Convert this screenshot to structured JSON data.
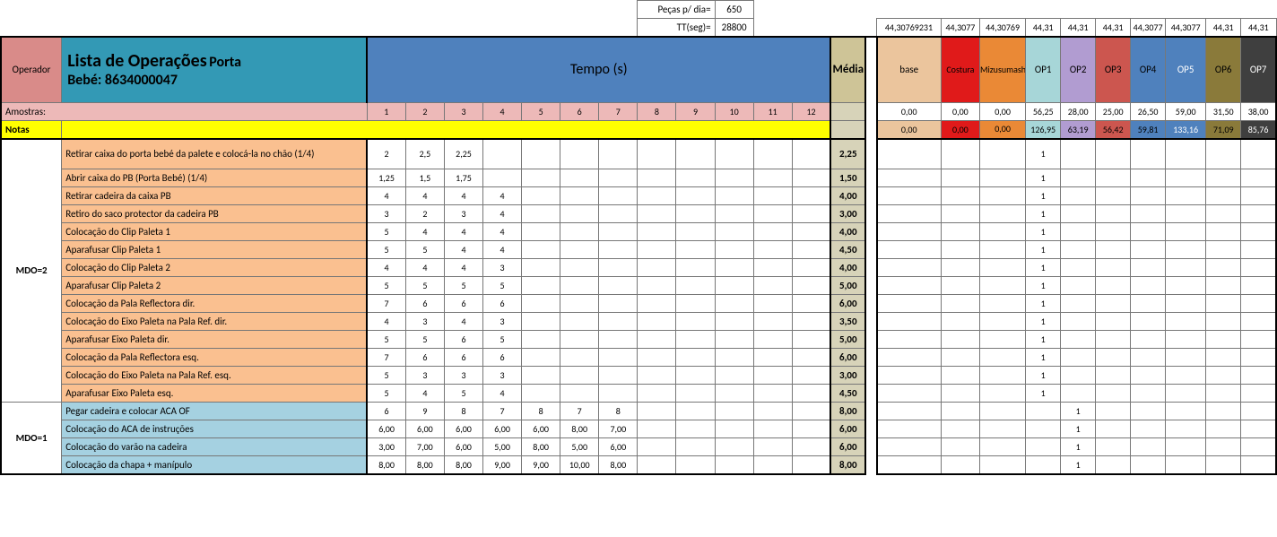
{
  "header": {
    "pecas_label": "Peças p/ dia=",
    "pecas_value": "650",
    "tt_label": "TT(seg)=",
    "tt_value": "28800",
    "top_right_values": [
      "44,30769231",
      "44,3077",
      "44,30769",
      "44,31",
      "44,31",
      "44,31",
      "44,3077",
      "44,3077",
      "44,31",
      "44,31"
    ],
    "operador": "Operador",
    "title_main": "Lista de Operações",
    "title_sub1": "Porta",
    "title_sub2": "Bebé: 8634000047",
    "tempo": "Tempo (s)",
    "media": "Média",
    "cols_op": [
      "base",
      "Costura",
      "Mizusumashi",
      "OP1",
      "OP2",
      "OP3",
      "OP4",
      "OP5",
      "OP6",
      "OP7"
    ],
    "amostras": "Amostras:",
    "samples": [
      "1",
      "2",
      "3",
      "4",
      "5",
      "6",
      "7",
      "8",
      "9",
      "10",
      "11",
      "12"
    ],
    "amostras_right": [
      "0,00",
      "0,00",
      "0,00",
      "56,25",
      "28,00",
      "25,00",
      "26,50",
      "59,00",
      "31,50",
      "38,00"
    ],
    "notas": "Notas",
    "notas_right": [
      "0,00",
      "0,00",
      "0,00",
      "126,95",
      "63,19",
      "56,42",
      "59,81",
      "133,16",
      "71,09",
      "85,76"
    ]
  },
  "groups": [
    {
      "mdo": "MDO=2",
      "rowclass": "op-row-orange",
      "rows": [
        {
          "desc": "Retirar caixa do porta bebé da palete e colocá-la no chão (1/4)",
          "t": [
            "2",
            "2,5",
            "2,25",
            "",
            "",
            "",
            "",
            "",
            "",
            "",
            "",
            ""
          ],
          "media": "2,25",
          "op": [
            "",
            "",
            "",
            "1",
            "",
            "",
            "",
            "",
            "",
            ""
          ]
        },
        {
          "desc": "Abrir caixa do PB (Porta Bebé) (1/4)",
          "t": [
            "1,25",
            "1,5",
            "1,75",
            "",
            "",
            "",
            "",
            "",
            "",
            "",
            "",
            ""
          ],
          "media": "1,50",
          "op": [
            "",
            "",
            "",
            "1",
            "",
            "",
            "",
            "",
            "",
            ""
          ]
        },
        {
          "desc": "Retirar cadeira da caixa PB",
          "t": [
            "4",
            "4",
            "4",
            "4",
            "",
            "",
            "",
            "",
            "",
            "",
            "",
            ""
          ],
          "media": "4,00",
          "op": [
            "",
            "",
            "",
            "1",
            "",
            "",
            "",
            "",
            "",
            ""
          ]
        },
        {
          "desc": "Retiro do saco protector da cadeira PB",
          "t": [
            "3",
            "2",
            "3",
            "4",
            "",
            "",
            "",
            "",
            "",
            "",
            "",
            ""
          ],
          "media": "3,00",
          "op": [
            "",
            "",
            "",
            "1",
            "",
            "",
            "",
            "",
            "",
            ""
          ]
        },
        {
          "desc": "Colocação do Clip Paleta 1",
          "t": [
            "5",
            "4",
            "4",
            "4",
            "",
            "",
            "",
            "",
            "",
            "",
            "",
            ""
          ],
          "media": "4,00",
          "op": [
            "",
            "",
            "",
            "1",
            "",
            "",
            "",
            "",
            "",
            ""
          ]
        },
        {
          "desc": "Aparafusar Clip Paleta 1",
          "t": [
            "5",
            "5",
            "4",
            "4",
            "",
            "",
            "",
            "",
            "",
            "",
            "",
            ""
          ],
          "media": "4,50",
          "op": [
            "",
            "",
            "",
            "1",
            "",
            "",
            "",
            "",
            "",
            ""
          ]
        },
        {
          "desc": "Colocação do Clip Paleta 2",
          "t": [
            "4",
            "4",
            "4",
            "3",
            "",
            "",
            "",
            "",
            "",
            "",
            "",
            ""
          ],
          "media": "4,00",
          "op": [
            "",
            "",
            "",
            "1",
            "",
            "",
            "",
            "",
            "",
            ""
          ]
        },
        {
          "desc": "Aparafusar Clip Paleta 2",
          "t": [
            "5",
            "5",
            "5",
            "5",
            "",
            "",
            "",
            "",
            "",
            "",
            "",
            ""
          ],
          "media": "5,00",
          "op": [
            "",
            "",
            "",
            "1",
            "",
            "",
            "",
            "",
            "",
            ""
          ]
        },
        {
          "desc": "Colocação da Pala Reflectora dir.",
          "t": [
            "7",
            "6",
            "6",
            "6",
            "",
            "",
            "",
            "",
            "",
            "",
            "",
            ""
          ],
          "media": "6,00",
          "op": [
            "",
            "",
            "",
            "1",
            "",
            "",
            "",
            "",
            "",
            ""
          ]
        },
        {
          "desc": "Colocação do Eixo Paleta na Pala Ref. dir.",
          "t": [
            "4",
            "3",
            "4",
            "3",
            "",
            "",
            "",
            "",
            "",
            "",
            "",
            ""
          ],
          "media": "3,50",
          "op": [
            "",
            "",
            "",
            "1",
            "",
            "",
            "",
            "",
            "",
            ""
          ]
        },
        {
          "desc": "Aparafusar Eixo Paleta dir.",
          "t": [
            "5",
            "5",
            "6",
            "5",
            "",
            "",
            "",
            "",
            "",
            "",
            "",
            ""
          ],
          "media": "5,00",
          "op": [
            "",
            "",
            "",
            "1",
            "",
            "",
            "",
            "",
            "",
            ""
          ]
        },
        {
          "desc": "Colocação da Pala Reflectora esq.",
          "t": [
            "7",
            "6",
            "6",
            "6",
            "",
            "",
            "",
            "",
            "",
            "",
            "",
            ""
          ],
          "media": "6,00",
          "op": [
            "",
            "",
            "",
            "1",
            "",
            "",
            "",
            "",
            "",
            ""
          ]
        },
        {
          "desc": "Colocação do Eixo Paleta na Pala Ref. esq.",
          "t": [
            "5",
            "3",
            "3",
            "3",
            "",
            "",
            "",
            "",
            "",
            "",
            "",
            ""
          ],
          "media": "3,00",
          "op": [
            "",
            "",
            "",
            "1",
            "",
            "",
            "",
            "",
            "",
            ""
          ]
        },
        {
          "desc": "Aparafusar Eixo Paleta esq.",
          "t": [
            "5",
            "4",
            "5",
            "4",
            "",
            "",
            "",
            "",
            "",
            "",
            "",
            ""
          ],
          "media": "4,50",
          "op": [
            "",
            "",
            "",
            "1",
            "",
            "",
            "",
            "",
            "",
            ""
          ]
        }
      ]
    },
    {
      "mdo": "MDO=1",
      "rowclass": "op-row-blue",
      "rows": [
        {
          "desc": "Pegar cadeira e colocar ACA OF",
          "t": [
            "6",
            "9",
            "8",
            "7",
            "8",
            "7",
            "8",
            "",
            "",
            "",
            "",
            ""
          ],
          "media": "8,00",
          "op": [
            "",
            "",
            "",
            "",
            "1",
            "",
            "",
            "",
            "",
            ""
          ]
        },
        {
          "desc": "Colocação do ACA de instruções",
          "t": [
            "6,00",
            "6,00",
            "6,00",
            "6,00",
            "6,00",
            "8,00",
            "7,00",
            "",
            "",
            "",
            "",
            ""
          ],
          "media": "6,00",
          "op": [
            "",
            "",
            "",
            "",
            "1",
            "",
            "",
            "",
            "",
            ""
          ]
        },
        {
          "desc": "Colocação do varão na cadeira",
          "t": [
            "3,00",
            "7,00",
            "6,00",
            "5,00",
            "8,00",
            "5,00",
            "6,00",
            "",
            "",
            "",
            "",
            ""
          ],
          "media": "6,00",
          "op": [
            "",
            "",
            "",
            "",
            "1",
            "",
            "",
            "",
            "",
            ""
          ]
        },
        {
          "desc": "Colocação da chapa + manípulo",
          "t": [
            "8,00",
            "8,00",
            "8,00",
            "9,00",
            "9,00",
            "10,00",
            "8,00",
            "",
            "",
            "",
            "",
            ""
          ],
          "media": "8,00",
          "op": [
            "",
            "",
            "",
            "",
            "1",
            "",
            "",
            "",
            "",
            ""
          ]
        }
      ]
    }
  ]
}
